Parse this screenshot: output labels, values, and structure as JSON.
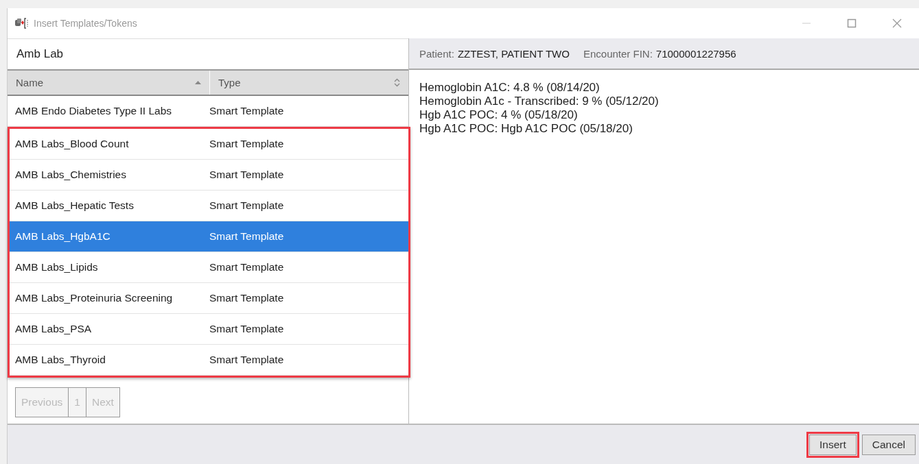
{
  "window": {
    "title": "Insert Templates/Tokens"
  },
  "left_panel": {
    "title": "Amb Lab",
    "columns": [
      {
        "label": "Name",
        "sorted": true
      },
      {
        "label": "Type",
        "sorted": false
      }
    ],
    "row_groups": [
      {
        "highlighted": false,
        "rows": [
          {
            "name": "AMB Endo Diabetes Type II Labs",
            "type": "Smart Template",
            "selected": false
          }
        ]
      },
      {
        "highlighted": true,
        "rows": [
          {
            "name": "AMB Labs_Blood Count",
            "type": "Smart Template",
            "selected": false
          },
          {
            "name": "AMB Labs_Chemistries",
            "type": "Smart Template",
            "selected": false
          },
          {
            "name": "AMB Labs_Hepatic Tests",
            "type": "Smart Template",
            "selected": false
          },
          {
            "name": "AMB Labs_HgbA1C",
            "type": "Smart Template",
            "selected": true
          },
          {
            "name": "AMB Labs_Lipids",
            "type": "Smart Template",
            "selected": false
          },
          {
            "name": "AMB Labs_Proteinuria Screening",
            "type": "Smart Template",
            "selected": false
          },
          {
            "name": "AMB Labs_PSA",
            "type": "Smart Template",
            "selected": false
          },
          {
            "name": "AMB Labs_Thyroid",
            "type": "Smart Template",
            "selected": false
          }
        ]
      }
    ],
    "pager": [
      {
        "label": "Previous",
        "disabled": true
      },
      {
        "label": "1",
        "disabled": true
      },
      {
        "label": "Next",
        "disabled": true
      }
    ]
  },
  "right_panel": {
    "patient_label": "Patient:",
    "patient": "ZZTEST, PATIENT TWO",
    "encounter_label": "Encounter FIN:",
    "encounter": "71000001227956",
    "preview_lines": [
      "Hemoglobin A1C: 4.8 % (08/14/20)",
      "Hemoglobin A1c - Transcribed: 9 % (05/12/20)",
      "Hgb A1C POC: 4 % (05/18/20)",
      "Hgb A1C POC: Hgb A1C POC (05/18/20)"
    ]
  },
  "buttons": [
    {
      "label": "Insert",
      "highlighted": true
    },
    {
      "label": "Cancel",
      "highlighted": false
    }
  ]
}
